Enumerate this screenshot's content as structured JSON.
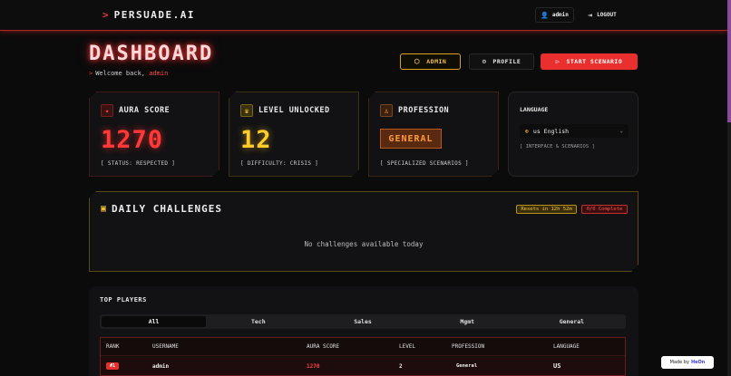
{
  "brand": {
    "chevron": ">",
    "name": "PERSUADE.AI"
  },
  "topbar": {
    "user": "admin",
    "logout": "LOGOUT"
  },
  "header": {
    "title": "DASHBOARD",
    "welcome_prefix": "Welcome back,",
    "username": "admin"
  },
  "actions": {
    "admin": "ADMIN",
    "profile": "PROFILE",
    "start": "START SCENARIO"
  },
  "cards": {
    "aura": {
      "label": "AURA SCORE",
      "value": "1270",
      "status": "[ STATUS: RESPECTED ]"
    },
    "level": {
      "label": "LEVEL UNLOCKED",
      "value": "12",
      "status": "[ DIFFICULTY: CRISIS ]"
    },
    "profession": {
      "label": "PROFESSION",
      "value": "GENERAL",
      "status": "[ SPECIALIZED SCENARIOS ]"
    },
    "language": {
      "label": "LANGUAGE",
      "selected": "us English",
      "note": "[ INTERFACE & SCENARIOS ]"
    }
  },
  "daily": {
    "title": "DAILY CHALLENGES",
    "resets": "Resets in 12h 52m",
    "complete": "0/0 Complete",
    "empty": "No challenges available today"
  },
  "players": {
    "title": "TOP PLAYERS",
    "tabs": [
      "All",
      "Tech",
      "Sales",
      "Mgmt",
      "General"
    ],
    "columns": [
      "RANK",
      "USERNAME",
      "AURA SCORE",
      "LEVEL",
      "PROFESSION",
      "LANGUAGE"
    ],
    "rows": [
      {
        "rank": "#1",
        "username": "admin",
        "aura": "1270",
        "level": "2",
        "profession": "General",
        "language": "US"
      }
    ]
  },
  "badge": {
    "prefix": "Made by",
    "brand": "HeOn"
  },
  "colors": {
    "accent_red": "#ea2f2f",
    "accent_yellow": "#f3c23a",
    "accent_orange": "#ff9a3a",
    "background": "#0b0b0c"
  },
  "icons": {
    "user": "user-icon",
    "logout": "logout-icon",
    "admin": "shield-icon",
    "profile": "gear-icon",
    "start": "play-icon",
    "aura": "star-icon",
    "level": "trophy-icon",
    "profession": "briefcase-icon",
    "globe": "globe-icon",
    "calendar": "calendar-icon"
  }
}
